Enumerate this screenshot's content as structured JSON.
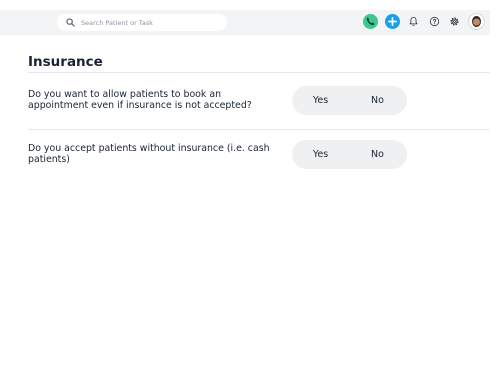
{
  "header": {
    "search_placeholder": "Search Patient or Task",
    "icons": {
      "search": "search-icon",
      "phone": "phone-icon",
      "add": "plus-icon",
      "notifications": "bell-icon",
      "help": "question-icon",
      "settings": "gear-icon",
      "avatar": "user-avatar"
    },
    "colors": {
      "phone": "#3bc792",
      "add": "#1aa0e8"
    }
  },
  "page": {
    "title": "Insurance",
    "questions": [
      {
        "text": "Do you want to allow patients to book an appointment even if insurance is not accepted?",
        "yes": "Yes",
        "no": "No"
      },
      {
        "text": "Do you accept patients without insurance (i.e. cash patients)",
        "yes": "Yes",
        "no": "No"
      }
    ]
  }
}
